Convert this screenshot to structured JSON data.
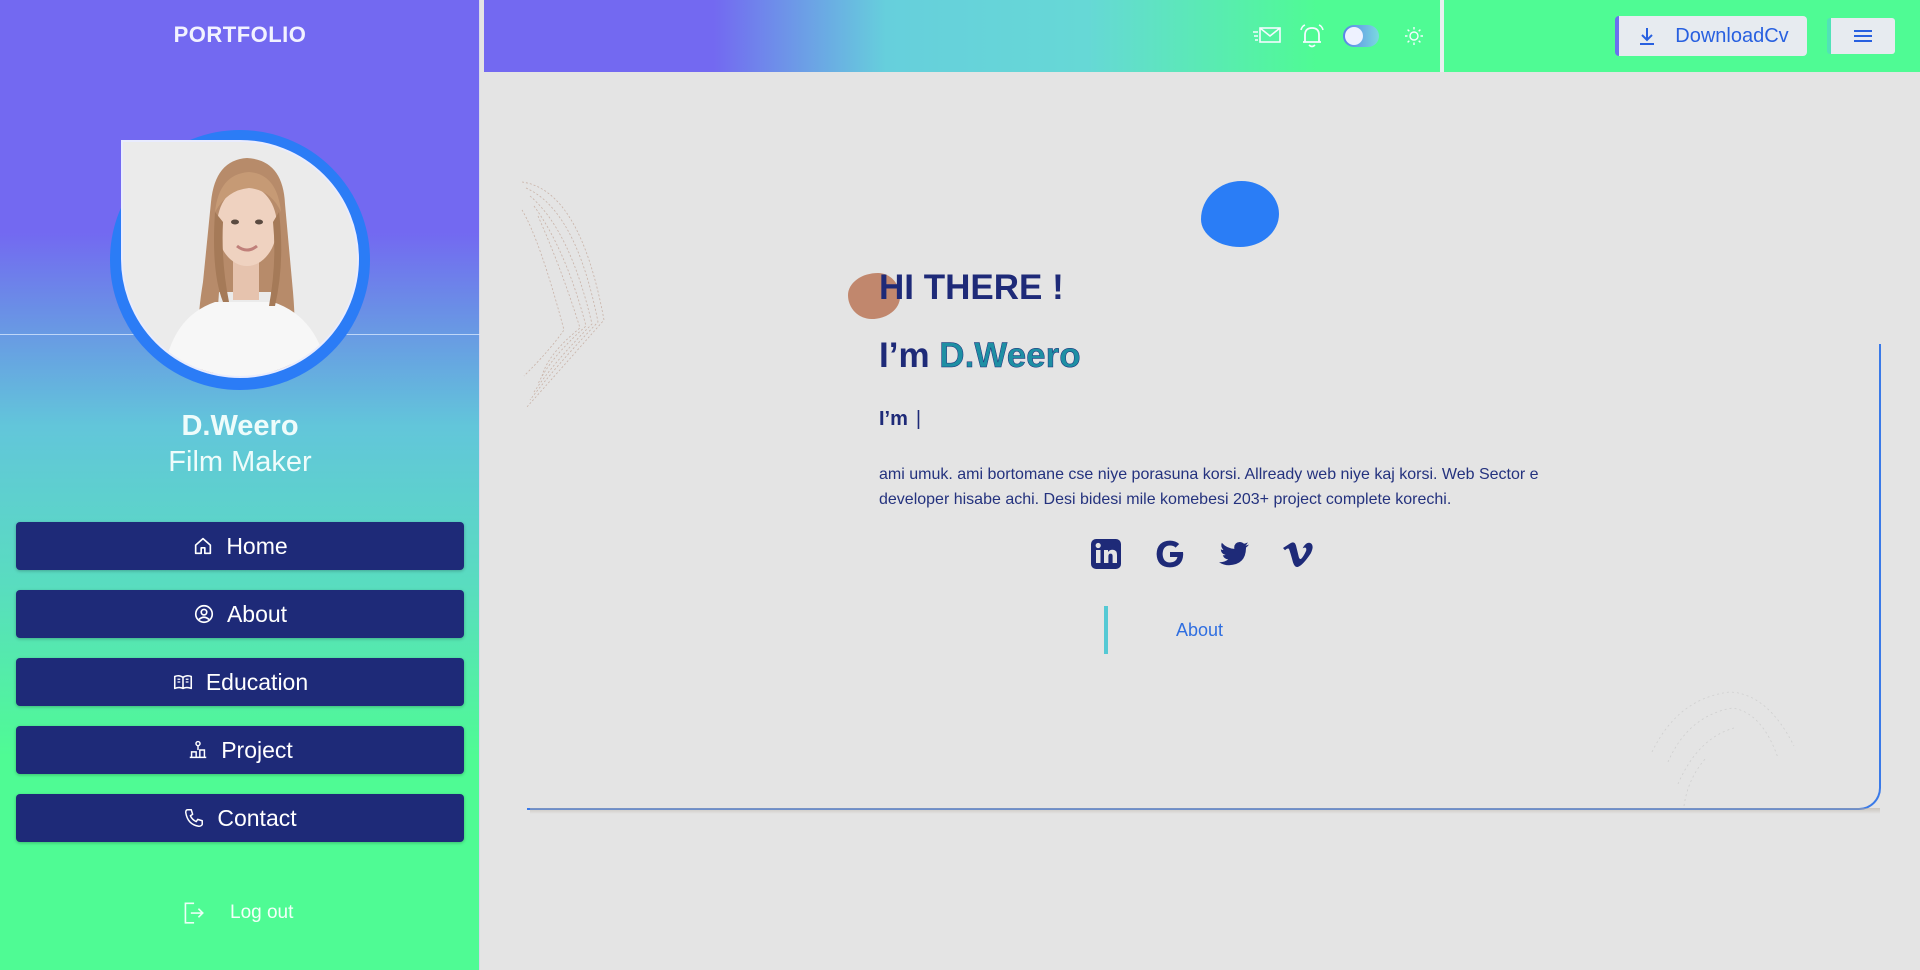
{
  "sidebar": {
    "brand": "PORTFOLIO",
    "profile": {
      "name": "D.Weero",
      "role": "Film Maker"
    },
    "nav": [
      {
        "label": "Home",
        "icon": "home-icon"
      },
      {
        "label": "About",
        "icon": "user-circle-icon"
      },
      {
        "label": "Education",
        "icon": "book-icon"
      },
      {
        "label": "Project",
        "icon": "project-icon"
      },
      {
        "label": "Contact",
        "icon": "phone-icon"
      }
    ],
    "logout": {
      "label": "Log out",
      "icon": "logout-icon"
    }
  },
  "topbar": {
    "icons": [
      "mail-icon",
      "bell-icon",
      "theme-toggle",
      "sun-icon"
    ],
    "download_label": "DownloadCv",
    "menu_icon": "hamburger-menu-icon"
  },
  "hero": {
    "greeting": "HI THERE !",
    "intro_prefix": "I’m ",
    "intro_name": "D.Weero",
    "typing_prefix": "I’m",
    "typing_caret": "|",
    "bio": "ami umuk. ami bortomane cse niye porasuna korsi. Allready web niye kaj korsi. Web Sector e developer hisabe achi. Desi bidesi mile komebesi 203+ project complete korechi.",
    "socials": [
      "linkedin-icon",
      "google-icon",
      "twitter-icon",
      "vimeo-icon"
    ],
    "about_link": "About"
  },
  "colors": {
    "navy": "#1e2a78",
    "accent_blue": "#2a7df6",
    "purple": "#7369f1",
    "green": "#4ffb94",
    "page_bg": "#e4e4e4"
  }
}
